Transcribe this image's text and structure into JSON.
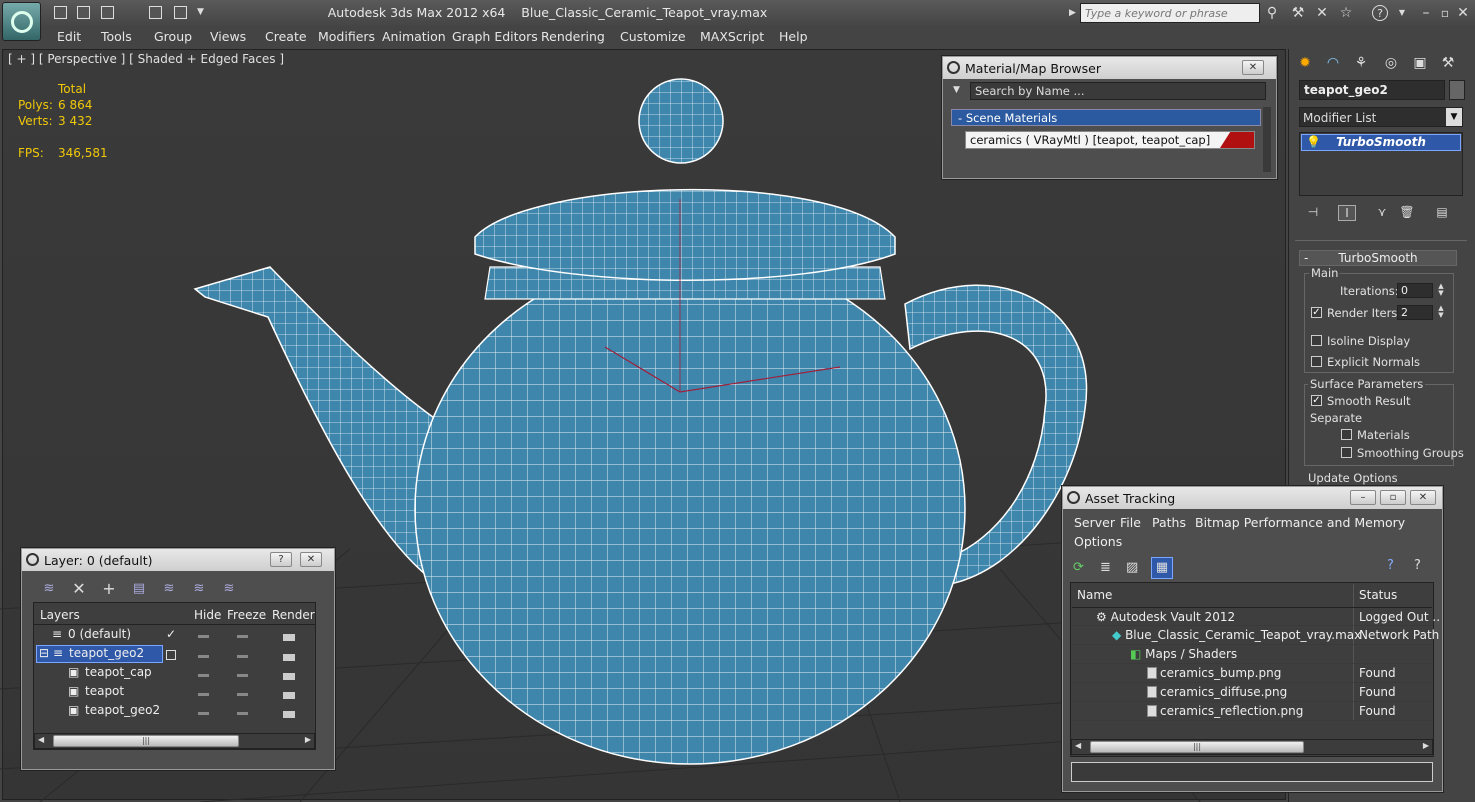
{
  "app": {
    "title_app": "Autodesk 3ds Max  2012 x64",
    "title_file": "Blue_Classic_Ceramic_Teapot_vray.max",
    "search_placeholder": "Type a keyword or phrase"
  },
  "menu": [
    "Edit",
    "Tools",
    "Group",
    "Views",
    "Create",
    "Modifiers",
    "Animation",
    "Graph Editors",
    "Rendering",
    "Customize",
    "MAXScript",
    "Help"
  ],
  "viewport": {
    "label": "[ + ] [ Perspective ] [ Shaded + Edged Faces ]",
    "stats": {
      "total_label": "Total",
      "polys_label": "Polys:",
      "polys_value": "6 864",
      "verts_label": "Verts:",
      "verts_value": "3 432",
      "fps_label": "FPS:",
      "fps_value": "346,581"
    },
    "colors": {
      "teapot": "#3f86ad",
      "wire": "#ffffff",
      "background": "#383838"
    }
  },
  "material_browser": {
    "title": "Material/Map Browser",
    "search_placeholder": "Search by Name ...",
    "section": "Scene Materials",
    "item": "ceramics  ( VRayMtl )  [teapot, teapot_cap]",
    "swatch_color": "#b01010"
  },
  "command_panel": {
    "object_name": "teapot_geo2",
    "modifier_list": "Modifier List",
    "stack_item": "TurboSmooth",
    "rollout_title": "TurboSmooth",
    "main_label": "Main",
    "iterations_label": "Iterations:",
    "iterations_value": "0",
    "render_iters_label": "Render Iters:",
    "render_iters_value": "2",
    "render_iters_checked": true,
    "isoline_label": "Isoline Display",
    "isoline_checked": false,
    "explicit_normals_label": "Explicit Normals",
    "explicit_normals_checked": false,
    "surface_params_label": "Surface Parameters",
    "smooth_result_label": "Smooth Result",
    "smooth_result_checked": true,
    "separate_label": "Separate",
    "materials_label": "Materials",
    "materials_checked": false,
    "smoothing_groups_label": "Smoothing Groups",
    "smoothing_groups_checked": false,
    "update_options_label": "Update Options"
  },
  "layer_panel": {
    "title": "Layer: 0 (default)",
    "help": "?",
    "columns": {
      "layers": "Layers",
      "hide": "Hide",
      "freeze": "Freeze",
      "render": "Render"
    },
    "rows": [
      {
        "name": "0 (default)",
        "indent": 0,
        "current": true
      },
      {
        "name": "teapot_geo2",
        "indent": 0,
        "selected": true
      },
      {
        "name": "teapot_cap",
        "indent": 1
      },
      {
        "name": "teapot",
        "indent": 1
      },
      {
        "name": "teapot_geo2",
        "indent": 1
      }
    ]
  },
  "asset_tracking": {
    "title": "Asset Tracking",
    "menu": [
      "Server",
      "File",
      "Paths",
      "Bitmap Performance and Memory",
      "Options"
    ],
    "columns": {
      "name": "Name",
      "status": "Status"
    },
    "rows": [
      {
        "name": "Autodesk Vault 2012",
        "status": "Logged Out ..",
        "level": 1
      },
      {
        "name": "Blue_Classic_Ceramic_Teapot_vray.max",
        "status": "Network Path",
        "level": 2
      },
      {
        "name": "Maps / Shaders",
        "status": "",
        "level": 3
      },
      {
        "name": "ceramics_bump.png",
        "status": "Found",
        "level": 4
      },
      {
        "name": "ceramics_diffuse.png",
        "status": "Found",
        "level": 4
      },
      {
        "name": "ceramics_reflection.png",
        "status": "Found",
        "level": 4
      }
    ]
  }
}
